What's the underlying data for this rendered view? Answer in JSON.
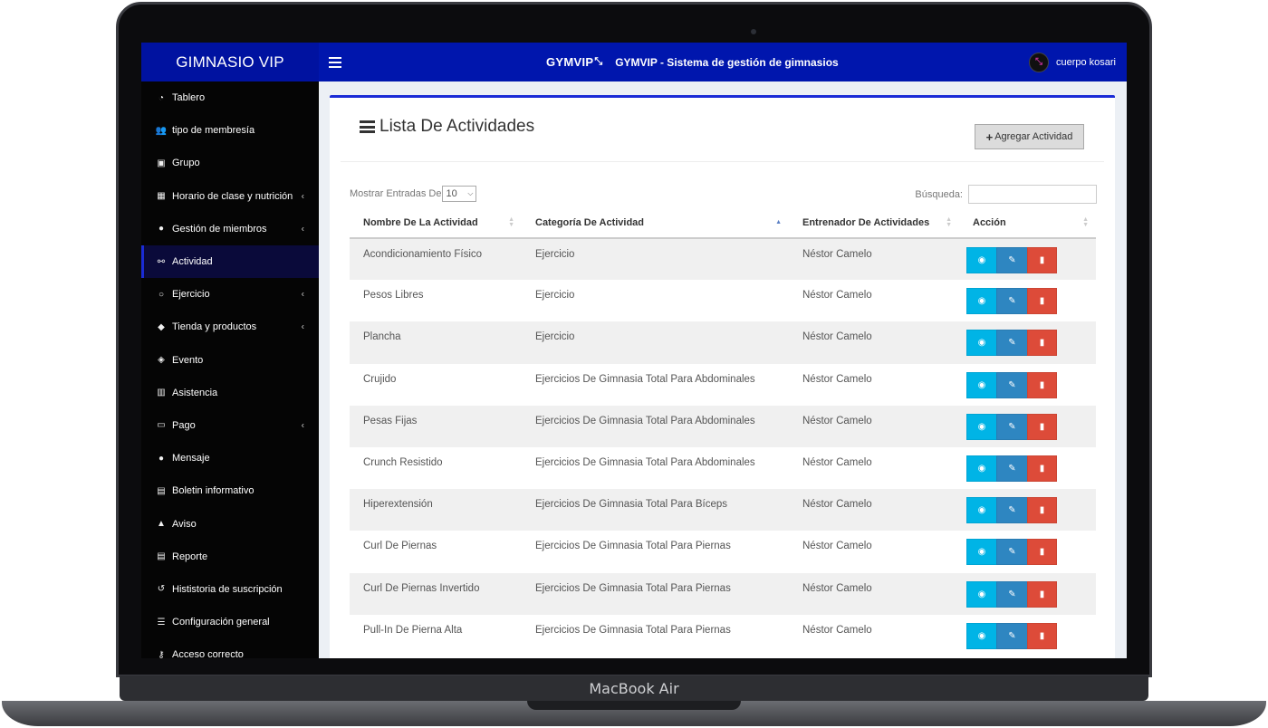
{
  "device": {
    "brand_label": "MacBook Air"
  },
  "header": {
    "app_name": "GIMNASIO VIP",
    "logo_text": "GYMVIP",
    "title": "GYMVIP - Sistema de gestión de gimnasios",
    "user_name": "cuerpo kosari",
    "colors": {
      "header_bg": "#0016ad",
      "sidebar_bg": "#050505",
      "accent": "#1a2bd6"
    }
  },
  "sidebar": {
    "items": [
      {
        "label": "Tablero",
        "icon": "pie-chart-icon",
        "glyph": "◔",
        "chevron": false,
        "active": false
      },
      {
        "label": "tipo de membresía",
        "icon": "users-icon",
        "glyph": "👥",
        "chevron": false,
        "active": false
      },
      {
        "label": "Grupo",
        "icon": "group-icon",
        "glyph": "▣",
        "chevron": false,
        "active": false
      },
      {
        "label": "Horario de clase y nutrición",
        "icon": "calendar-icon",
        "glyph": "▦",
        "chevron": true,
        "active": false
      },
      {
        "label": "Gestión de miembros",
        "icon": "user-icon",
        "glyph": "●",
        "chevron": true,
        "active": false
      },
      {
        "label": "Actividad",
        "icon": "bicycle-icon",
        "glyph": "⚯",
        "chevron": false,
        "active": true
      },
      {
        "label": "Ejercicio",
        "icon": "exercise-icon",
        "glyph": "○",
        "chevron": true,
        "active": false
      },
      {
        "label": "Tienda y productos",
        "icon": "tag-icon",
        "glyph": "◆",
        "chevron": true,
        "active": false
      },
      {
        "label": "Evento",
        "icon": "ticket-icon",
        "glyph": "◈",
        "chevron": false,
        "active": false
      },
      {
        "label": "Asistencia",
        "icon": "attendance-icon",
        "glyph": "▥",
        "chevron": false,
        "active": false
      },
      {
        "label": "Pago",
        "icon": "money-icon",
        "glyph": "▭",
        "chevron": true,
        "active": false
      },
      {
        "label": "Mensaje",
        "icon": "chat-icon",
        "glyph": "●",
        "chevron": false,
        "active": false
      },
      {
        "label": "Boletin informativo",
        "icon": "newsletter-icon",
        "glyph": "▤",
        "chevron": false,
        "active": false
      },
      {
        "label": "Aviso",
        "icon": "bell-icon",
        "glyph": "▲",
        "chevron": false,
        "active": false
      },
      {
        "label": "Reporte",
        "icon": "report-icon",
        "glyph": "▤",
        "chevron": false,
        "active": false
      },
      {
        "label": "Hististoria de suscripción",
        "icon": "history-icon",
        "glyph": "↺",
        "chevron": false,
        "active": false
      },
      {
        "label": "Configuración general",
        "icon": "sliders-icon",
        "glyph": "☰",
        "chevron": false,
        "active": false
      },
      {
        "label": "Acceso correcto",
        "icon": "key-icon",
        "glyph": "⚷",
        "chevron": false,
        "active": false
      }
    ]
  },
  "main": {
    "title": "Lista De Actividades",
    "add_button": "Agregar Actividad",
    "entries_label": "Mostrar Entradas De",
    "entries_value": "10",
    "search_label": "Búsqueda:",
    "search_value": "",
    "columns": [
      "Nombre De La Actividad",
      "Categoría De Actividad",
      "Entrenador De Actividades",
      "Acción"
    ],
    "rows": [
      {
        "name": "Acondicionamiento Físico",
        "category": "Ejercicio",
        "trainer": "Néstor Camelo"
      },
      {
        "name": "Pesos Libres",
        "category": "Ejercicio",
        "trainer": "Néstor Camelo"
      },
      {
        "name": "Plancha",
        "category": "Ejercicio",
        "trainer": "Néstor Camelo"
      },
      {
        "name": "Crujido",
        "category": "Ejercicios De Gimnasia Total Para Abdominales",
        "trainer": "Néstor Camelo"
      },
      {
        "name": "Pesas Fijas",
        "category": "Ejercicios De Gimnasia Total Para Abdominales",
        "trainer": "Néstor Camelo"
      },
      {
        "name": "Crunch Resistido",
        "category": "Ejercicios De Gimnasia Total Para Abdominales",
        "trainer": "Néstor Camelo"
      },
      {
        "name": "Hiperextensión",
        "category": "Ejercicios De Gimnasia Total Para Bíceps",
        "trainer": "Néstor Camelo"
      },
      {
        "name": "Curl De Piernas",
        "category": "Ejercicios De Gimnasia Total Para Piernas",
        "trainer": "Néstor Camelo"
      },
      {
        "name": "Curl De Piernas Invertido",
        "category": "Ejercicios De Gimnasia Total Para Piernas",
        "trainer": "Néstor Camelo"
      },
      {
        "name": "Pull-In De Pierna Alta",
        "category": "Ejercicios De Gimnasia Total Para Piernas",
        "trainer": "Néstor Camelo"
      }
    ]
  }
}
